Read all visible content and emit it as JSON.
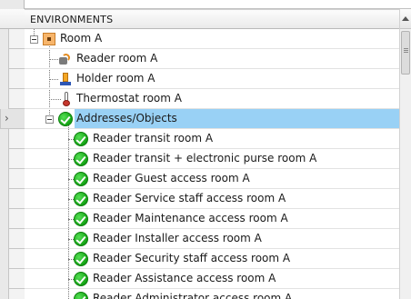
{
  "header": {
    "column_title": "ENVIRONMENTS"
  },
  "tree": {
    "room": {
      "label": "Room A",
      "icon": "room-icon"
    },
    "devices": [
      {
        "label": "Reader room A",
        "icon": "reader-icon"
      },
      {
        "label": "Holder room A",
        "icon": "holder-icon"
      },
      {
        "label": "Thermostat room A",
        "icon": "thermostat-icon"
      }
    ],
    "group": {
      "label": "Addresses/Objects",
      "icon": "check-icon",
      "selected": true
    },
    "objects": [
      {
        "label": "Reader transit room A"
      },
      {
        "label": "Reader transit + electronic purse room A"
      },
      {
        "label": "Reader Guest access room A"
      },
      {
        "label": "Reader Service staff access room A"
      },
      {
        "label": "Reader Maintenance access room A"
      },
      {
        "label": "Reader Installer access room A"
      },
      {
        "label": "Reader Security staff access room A"
      },
      {
        "label": "Reader Assistance access room A"
      },
      {
        "label": "Reader Administrator access room A"
      }
    ]
  },
  "colors": {
    "selection": "#99d1f5",
    "check_green": "#14a314"
  }
}
